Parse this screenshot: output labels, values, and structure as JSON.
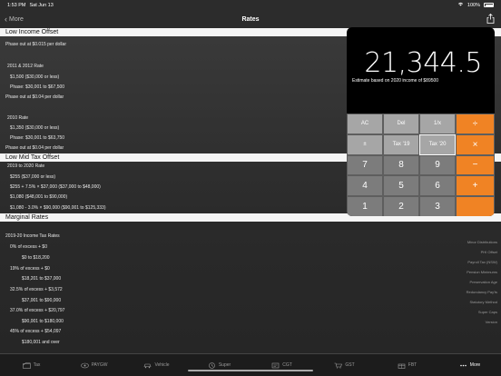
{
  "status_bar": {
    "time": "1:53 PM",
    "date": "Sat Jun 13",
    "battery": "100%"
  },
  "nav": {
    "back_label": "More",
    "title": "Rates"
  },
  "sections": {
    "low_income": {
      "title": "Low Income Offset",
      "lines": [
        "Phase out at $0.015 per dollar",
        "2011 & 2012 Rate",
        "$1,500 ($30,000 or less)",
        "Phase: $30,001 to $67,500",
        "Phase out at $0.04 per dollar",
        "2010 Rate",
        "$1,350 ($30,000 or less)",
        "Phase: $30,001 to $63,750",
        "Phase out at $0.04 per dollar"
      ]
    },
    "low_mid": {
      "title": "Low Mid Tax Offset",
      "lines": [
        "2019 to 2020 Rate",
        "$255 ($37,000 or less)",
        "$255 + 7.5% × $37,000 ($37,000 to $48,000)",
        "$1,080 ($48,001 to $90,000)",
        "$1,080 - 3.0% × $90,000 ($90,001 to $125,333)"
      ]
    },
    "marginal": {
      "title": "Marginal Rates",
      "lines": [
        "2019-20 Income Tax Rates",
        "0% of excess + $0",
        "$0 to $18,200",
        "19% of excess + $0",
        "$18,201 to $37,000",
        "32.5% of excess + $3,572",
        "$37,001 to $90,000",
        "37.0% of excess + $20,797",
        "$90,001 to $180,000",
        "45% of excess + $54,097",
        "$180,001 and over"
      ]
    }
  },
  "side_menu": [
    "Minor Distributions",
    "PHI Offset",
    "Payroll Tax (NSW)",
    "Pension Minimums",
    "Preservation Age",
    "Redundancy Pay'ts",
    "Statutory Method",
    "Super Caps",
    "Version"
  ],
  "calculator": {
    "display": "21,344.5",
    "note": "Estimate based on 2020 income of $89500",
    "keys": [
      [
        "AC",
        "Del",
        "1/x",
        "÷"
      ],
      [
        "±",
        "Tax '19",
        "Tax '20",
        "×"
      ],
      [
        "7",
        "8",
        "9",
        "−"
      ],
      [
        "4",
        "5",
        "6",
        "+"
      ],
      [
        "1",
        "2",
        "3",
        ""
      ],
      [
        "0",
        ".",
        "",
        "="
      ]
    ]
  },
  "tabs": [
    "Tax",
    "PAYGW",
    "Vehicle",
    "Super",
    "CGT",
    "GST",
    "FBT",
    "More"
  ]
}
